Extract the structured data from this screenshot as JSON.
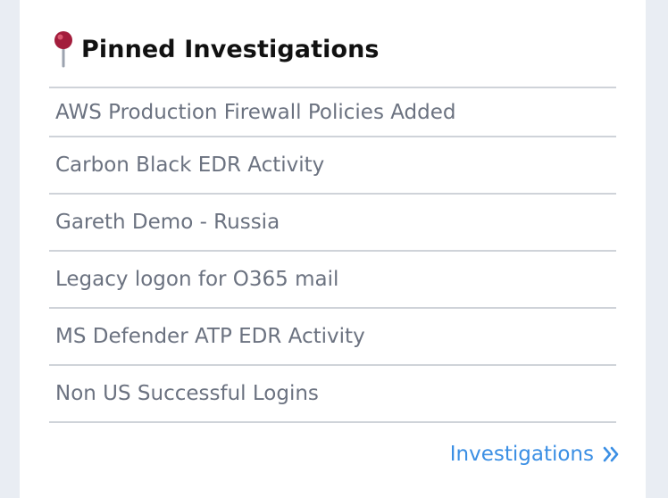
{
  "widget": {
    "title": "Pinned Investigations",
    "header_icon": "pin-icon",
    "accent_color": "#a31d3c",
    "items": [
      {
        "label": "AWS Production Firewall Policies Added"
      },
      {
        "label": "Carbon Black EDR Activity"
      },
      {
        "label": "Gareth Demo - Russia"
      },
      {
        "label": "Legacy logon for O365 mail"
      },
      {
        "label": "MS Defender ATP EDR Activity"
      },
      {
        "label": "Non US Successful Logins"
      }
    ],
    "footer_link": {
      "label": "Investigations",
      "icon": "double-chevron-right-icon",
      "color": "#3b8fe4"
    }
  }
}
